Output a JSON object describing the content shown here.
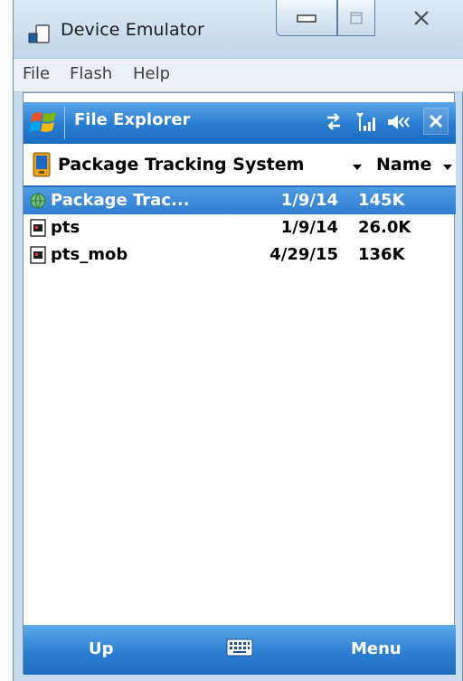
{
  "window": {
    "title": "Device Emulator"
  },
  "menubar": {
    "items": [
      {
        "label": "File"
      },
      {
        "label": "Flash"
      },
      {
        "label": "Help"
      }
    ]
  },
  "device": {
    "title": "File Explorer",
    "folder": {
      "name": "Package Tracking System",
      "sort_label": "Name"
    },
    "files": [
      {
        "name": "Package Trac...",
        "date": "1/9/14",
        "size": "145K",
        "selected": true,
        "icon": "app-globe-icon"
      },
      {
        "name": "pts",
        "date": "1/9/14",
        "size": "26.0K",
        "selected": false,
        "icon": "exe-file-icon"
      },
      {
        "name": "pts_mob",
        "date": "4/29/15",
        "size": "136K",
        "selected": false,
        "icon": "exe-file-icon"
      }
    ],
    "softkeys": {
      "left": "Up",
      "right": "Menu"
    }
  },
  "colors": {
    "accent": "#2b7fd2",
    "selection": "#3a88d8"
  }
}
